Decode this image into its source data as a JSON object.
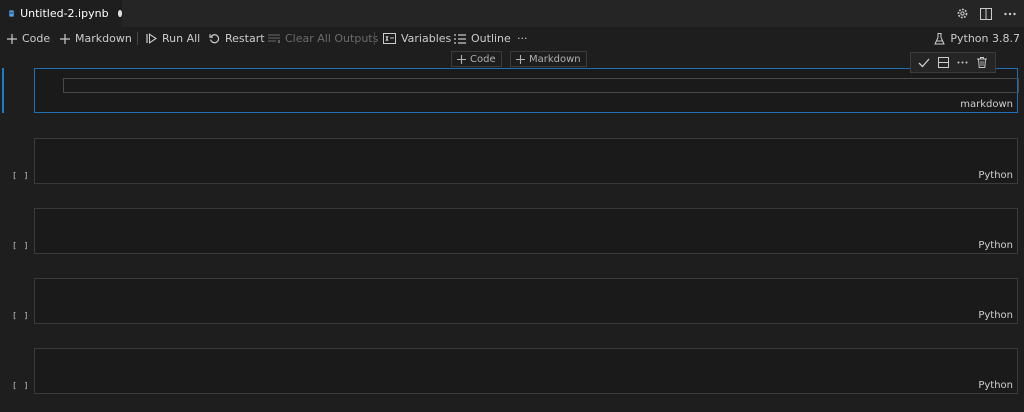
{
  "tab": {
    "name": "Untitled-2.ipynb",
    "dirty": true
  },
  "toolbar": {
    "code_label": "Code",
    "markdown_label": "Markdown",
    "run_all_label": "Run All",
    "restart_label": "Restart",
    "clear_outputs_label": "Clear All Outputs",
    "variables_label": "Variables",
    "outline_label": "Outline",
    "more_label": "···",
    "kernel_label": "Python 3.8.7"
  },
  "insert": {
    "code_label": "Code",
    "markdown_label": "Markdown"
  },
  "cells": [
    {
      "language": "markdown",
      "exec": ""
    },
    {
      "language": "Python",
      "exec": "[ ]"
    },
    {
      "language": "Python",
      "exec": "[ ]"
    },
    {
      "language": "Python",
      "exec": "[ ]"
    },
    {
      "language": "Python",
      "exec": "[ ]"
    }
  ],
  "colors": {
    "background": "#1e1e1e",
    "focus_border": "#1f6fb5",
    "accent": "#1f79c9"
  }
}
